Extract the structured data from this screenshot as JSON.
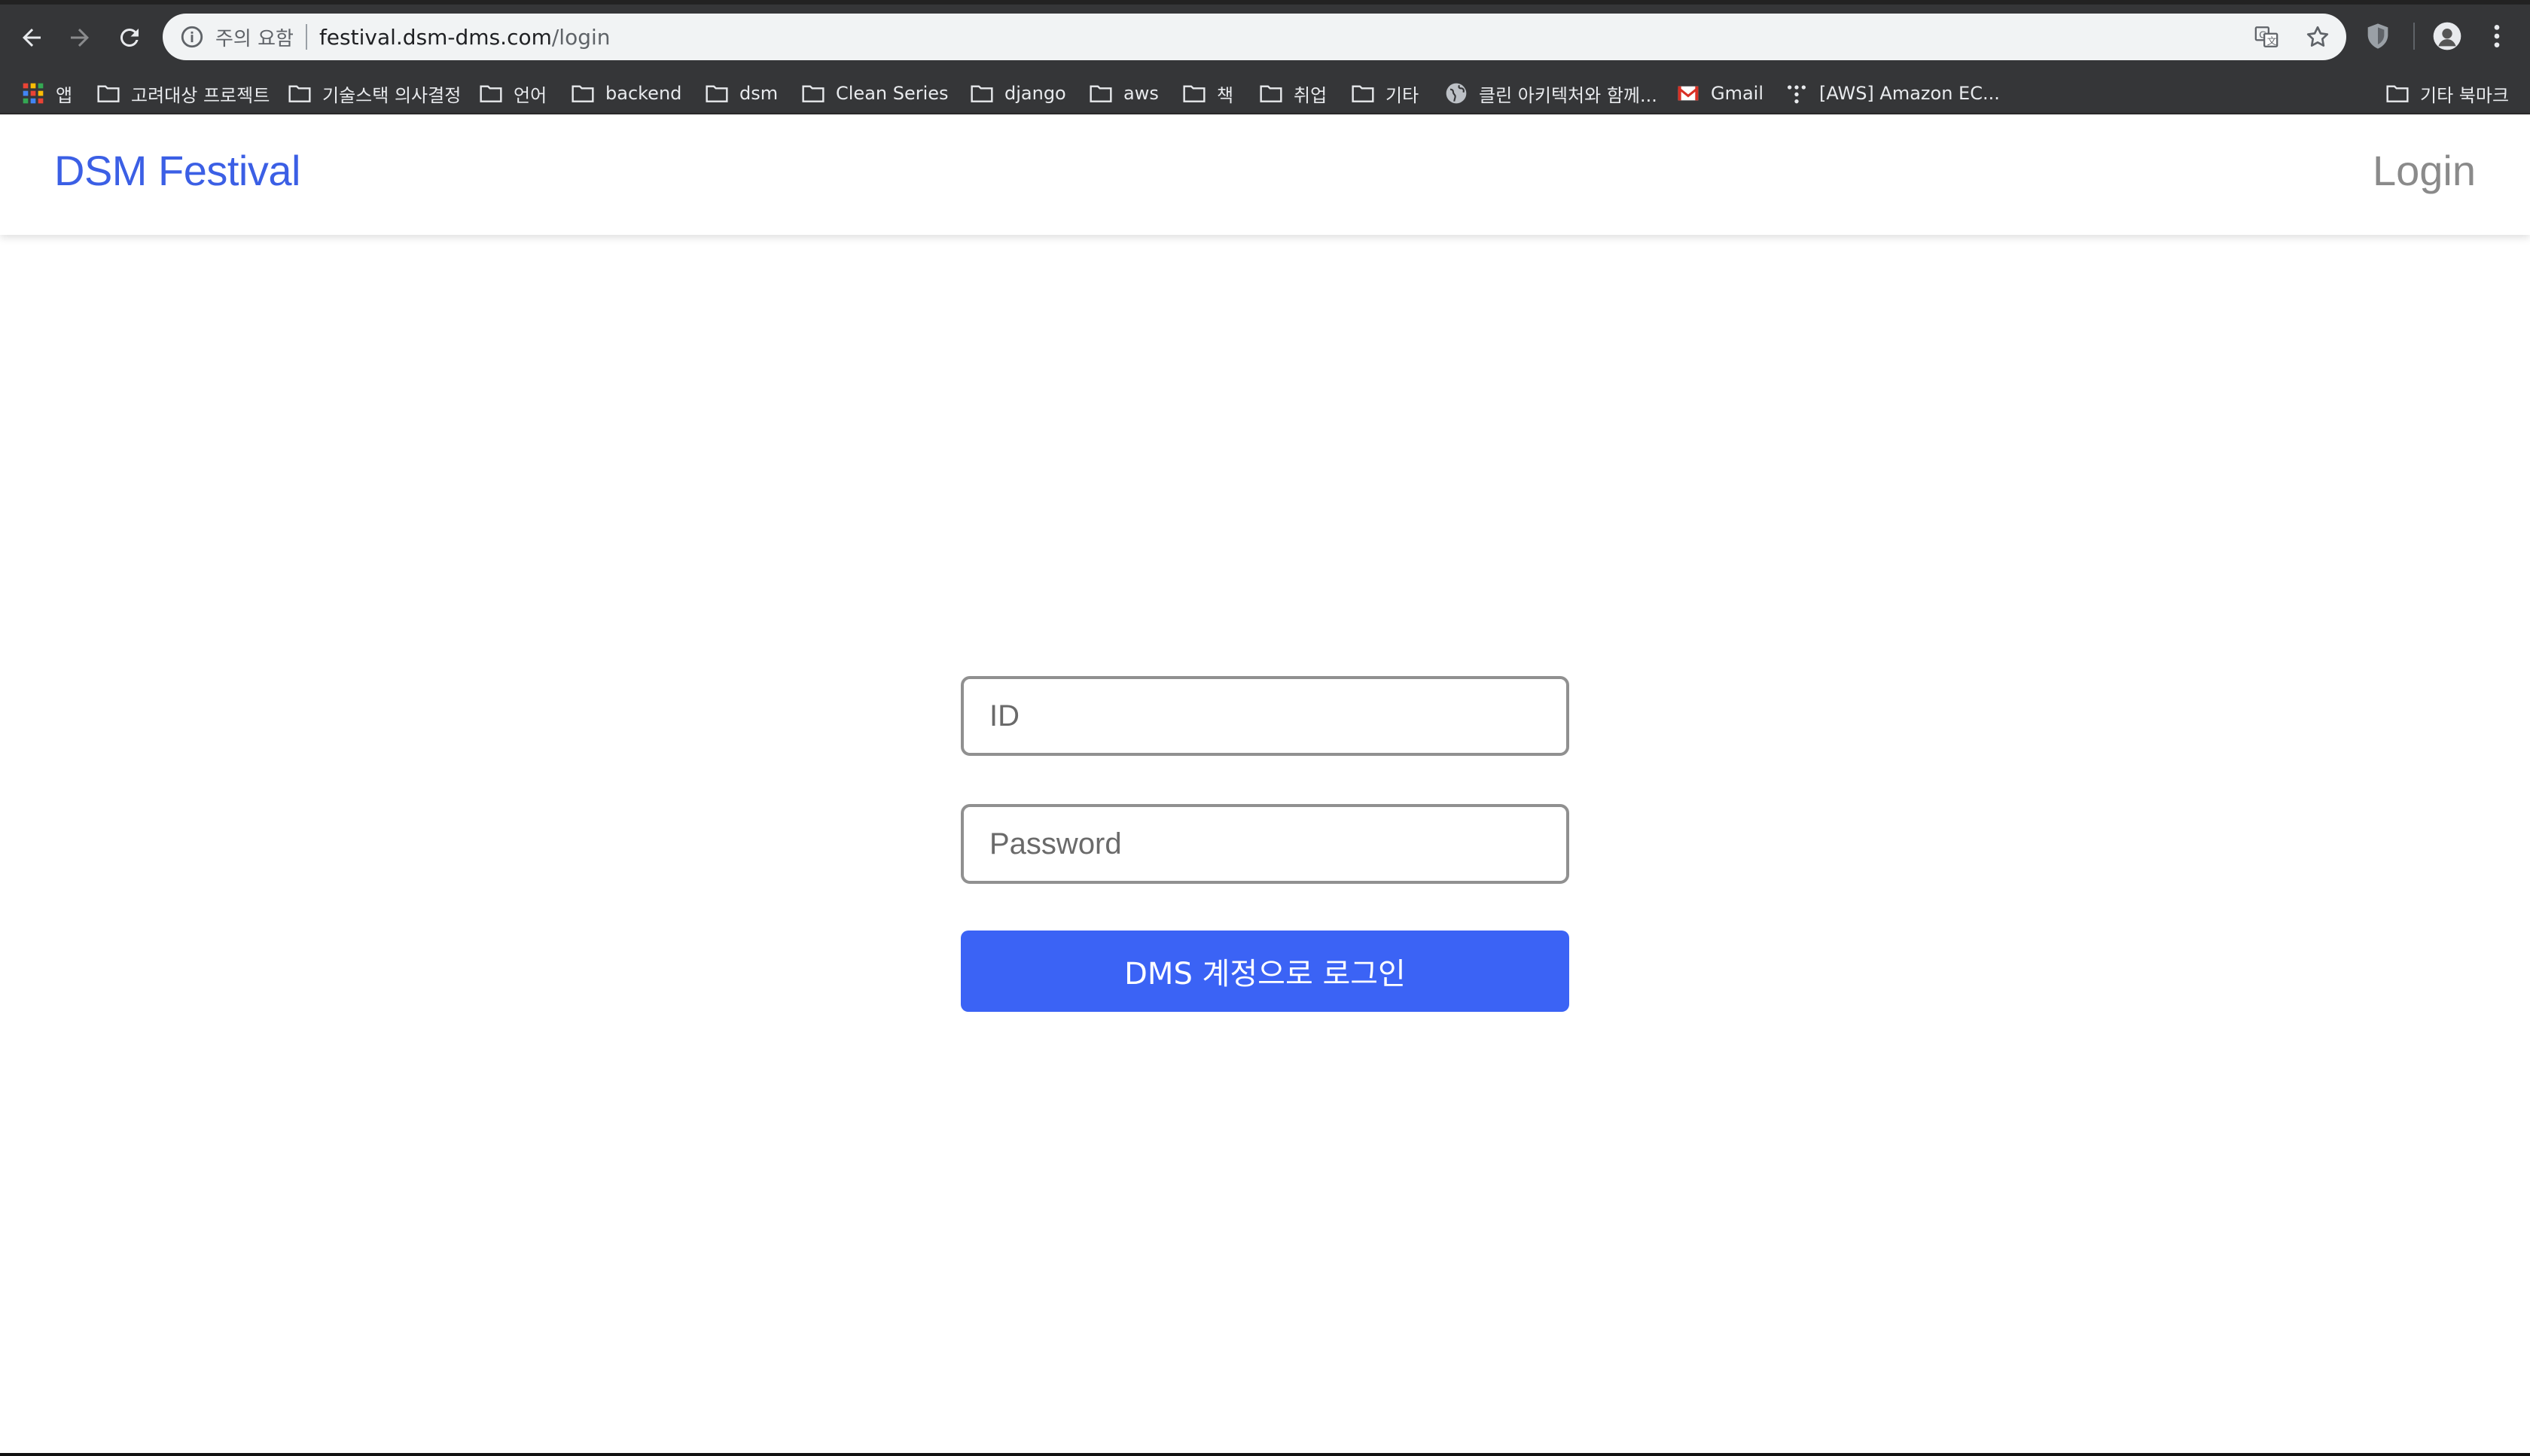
{
  "browser": {
    "security_label": "주의 요함",
    "url_host": "festival.dsm-dms.com",
    "url_path": "/login"
  },
  "bookmarks": {
    "apps_label": "앱",
    "items": [
      {
        "label": "고려대상 프로젝트",
        "icon": "folder-icon"
      },
      {
        "label": "기술스택 의사결정",
        "icon": "folder-icon"
      },
      {
        "label": "언어",
        "icon": "folder-icon"
      },
      {
        "label": "backend",
        "icon": "folder-icon"
      },
      {
        "label": "dsm",
        "icon": "folder-icon"
      },
      {
        "label": "Clean Series",
        "icon": "folder-icon"
      },
      {
        "label": "django",
        "icon": "folder-icon"
      },
      {
        "label": "aws",
        "icon": "folder-icon"
      },
      {
        "label": "책",
        "icon": "folder-icon"
      },
      {
        "label": "취업",
        "icon": "folder-icon"
      },
      {
        "label": "기타",
        "icon": "folder-icon"
      },
      {
        "label": "클린 아키텍처와 함께...",
        "icon": "globe-icon"
      },
      {
        "label": "Gmail",
        "icon": "gmail-icon"
      },
      {
        "label": "[AWS] Amazon EC...",
        "icon": "aws-dots-icon"
      }
    ],
    "other_label": "기타 북마크"
  },
  "app": {
    "brand": "DSM Festival",
    "login_link": "Login",
    "accent_color": "#3b63f5"
  },
  "form": {
    "id_placeholder": "ID",
    "id_value": "",
    "password_placeholder": "Password",
    "password_value": "",
    "submit_label": "DMS 계정으로 로그인"
  }
}
